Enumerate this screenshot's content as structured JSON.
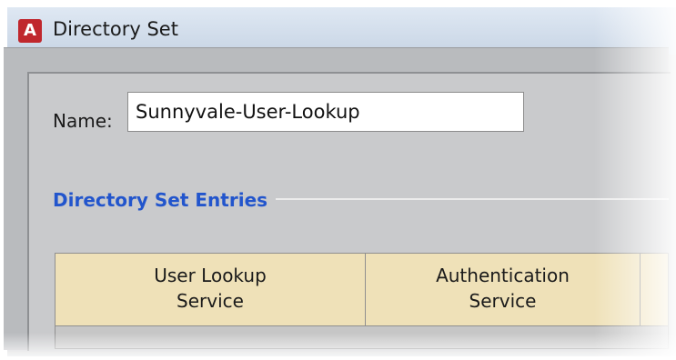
{
  "window": {
    "title": "Directory Set",
    "app_icon_glyph": "A",
    "app_icon_color": "#c0272d"
  },
  "form": {
    "name_label": "Name:",
    "name_value": "Sunnyvale-User-Lookup"
  },
  "section": {
    "title": "Directory Set Entries",
    "title_color": "#2255cc"
  },
  "table": {
    "header_color": "#efe1b8",
    "columns": [
      {
        "line1": "User Lookup",
        "line2": "Service"
      },
      {
        "line1": "Authentication",
        "line2": "Service"
      },
      {
        "line1": "",
        "line2": ""
      }
    ]
  }
}
